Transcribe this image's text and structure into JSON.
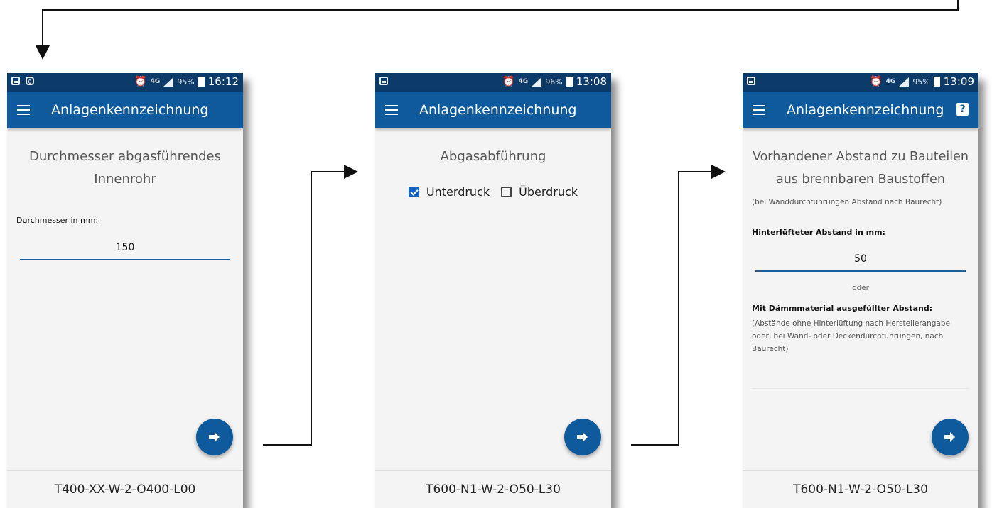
{
  "screens": [
    {
      "status": {
        "time": "16:12",
        "battery": "95%",
        "network": "4G"
      },
      "title": "Anlagenkennzeichnung",
      "heading": "Durchmesser abgasführendes Innenrohr",
      "field_label": "Durchmesser in mm:",
      "field_value": "150",
      "code": "T400-XX-W-2-O400-L00"
    },
    {
      "status": {
        "time": "13:08",
        "battery": "96%",
        "network": "4G"
      },
      "title": "Anlagenkennzeichnung",
      "heading": "Abgasabführung",
      "options": [
        {
          "label": "Unterdruck",
          "checked": true
        },
        {
          "label": "Überdruck",
          "checked": false
        }
      ],
      "code": "T600-N1-W-2-O50-L30"
    },
    {
      "status": {
        "time": "13:09",
        "battery": "95%",
        "network": "4G"
      },
      "title": "Anlagenkennzeichnung",
      "heading": "Vorhandener Abstand zu Bauteilen aus brennbaren Baustoffen",
      "subnote": "(bei Wanddurchführungen Abstand nach Baurecht)",
      "field_label": "Hinterlüfteter Abstand in mm:",
      "field_value": "50",
      "or_text": "oder",
      "field2_label": "Mit Dämmmaterial ausgefüllter Abstand:",
      "field2_note": "(Abstände ohne Hinterlüftung nach Herstellerangabe oder, bei Wand- oder Deckendurchführungen, nach Baurecht)",
      "code": "T600-N1-W-2-O50-L30"
    }
  ],
  "colors": {
    "appbar": "#0f5a9c",
    "statusbar": "#0c3a69",
    "accent": "#1565c0"
  },
  "icons": [
    "menu-icon",
    "help-icon",
    "arrow-right-icon",
    "checkbox-icon",
    "alarm-icon",
    "signal-icon",
    "battery-icon"
  ]
}
